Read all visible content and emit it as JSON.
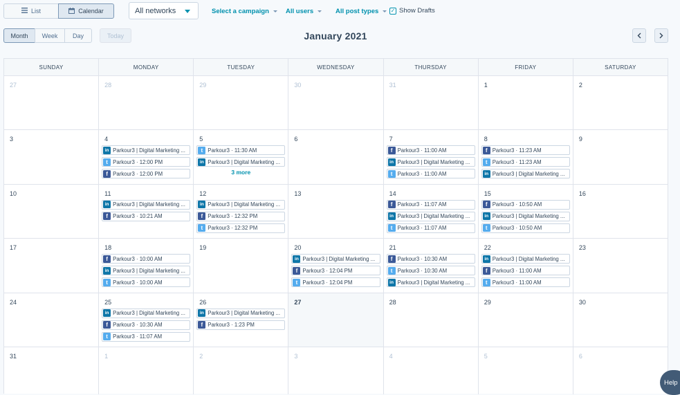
{
  "toolbar": {
    "view_toggle": {
      "list_label": "List",
      "calendar_label": "Calendar",
      "active": "Calendar"
    },
    "network_select": {
      "value": "All networks"
    },
    "campaign_filter": "Select a campaign",
    "users_filter": "All users",
    "post_types_filter": "All post types",
    "show_drafts": {
      "label": "Show Drafts",
      "checked": true
    }
  },
  "range_toggle": {
    "month": "Month",
    "week": "Week",
    "day": "Day",
    "active": "Month"
  },
  "today_label": "Today",
  "month_title": "January 2021",
  "nav": {
    "prev": "‹",
    "next": "›"
  },
  "weekdays": [
    "SUNDAY",
    "MONDAY",
    "TUESDAY",
    "WEDNESDAY",
    "THURSDAY",
    "FRIDAY",
    "SATURDAY"
  ],
  "weeks": [
    {
      "days": [
        {
          "num": "27",
          "other": true,
          "posts": []
        },
        {
          "num": "28",
          "other": true,
          "posts": []
        },
        {
          "num": "29",
          "other": true,
          "posts": []
        },
        {
          "num": "30",
          "other": true,
          "posts": []
        },
        {
          "num": "31",
          "other": true,
          "posts": []
        },
        {
          "num": "1",
          "posts": []
        },
        {
          "num": "2",
          "posts": []
        }
      ]
    },
    {
      "days": [
        {
          "num": "3",
          "posts": []
        },
        {
          "num": "4",
          "posts": [
            {
              "network": "linkedin",
              "text": "Parkour3 | Digital Marketing ..."
            },
            {
              "network": "twitter",
              "text": "Parkour3 · 12:00 PM"
            },
            {
              "network": "facebook",
              "text": "Parkour3 · 12:00 PM"
            }
          ]
        },
        {
          "num": "5",
          "posts": [
            {
              "network": "twitter",
              "text": "Parkour3 · 11:30 AM"
            },
            {
              "network": "linkedin",
              "text": "Parkour3 | Digital Marketing ..."
            }
          ],
          "more": "3 more"
        },
        {
          "num": "6",
          "posts": []
        },
        {
          "num": "7",
          "posts": [
            {
              "network": "facebook",
              "text": "Parkour3 · 11:00 AM"
            },
            {
              "network": "linkedin",
              "text": "Parkour3 | Digital Marketing ..."
            },
            {
              "network": "twitter",
              "text": "Parkour3 · 11:00 AM"
            }
          ]
        },
        {
          "num": "8",
          "posts": [
            {
              "network": "facebook",
              "text": "Parkour3 · 11:23 AM"
            },
            {
              "network": "twitter",
              "text": "Parkour3 · 11:23 AM"
            },
            {
              "network": "linkedin",
              "text": "Parkour3 | Digital Marketing ..."
            }
          ]
        },
        {
          "num": "9",
          "posts": []
        }
      ]
    },
    {
      "days": [
        {
          "num": "10",
          "posts": []
        },
        {
          "num": "11",
          "posts": [
            {
              "network": "linkedin",
              "text": "Parkour3 | Digital Marketing ..."
            },
            {
              "network": "facebook",
              "text": "Parkour3 · 10:21 AM"
            }
          ]
        },
        {
          "num": "12",
          "posts": [
            {
              "network": "linkedin",
              "text": "Parkour3 | Digital Marketing ..."
            },
            {
              "network": "facebook",
              "text": "Parkour3 · 12:32 PM"
            },
            {
              "network": "twitter",
              "text": "Parkour3 · 12:32 PM"
            }
          ]
        },
        {
          "num": "13",
          "posts": []
        },
        {
          "num": "14",
          "posts": [
            {
              "network": "facebook",
              "text": "Parkour3 · 11:07 AM"
            },
            {
              "network": "linkedin",
              "text": "Parkour3 | Digital Marketing ..."
            },
            {
              "network": "twitter",
              "text": "Parkour3 · 11:07 AM"
            }
          ]
        },
        {
          "num": "15",
          "posts": [
            {
              "network": "facebook",
              "text": "Parkour3 · 10:50 AM"
            },
            {
              "network": "linkedin",
              "text": "Parkour3 | Digital Marketing ..."
            },
            {
              "network": "twitter",
              "text": "Parkour3 · 10:50 AM"
            }
          ]
        },
        {
          "num": "16",
          "posts": []
        }
      ]
    },
    {
      "days": [
        {
          "num": "17",
          "posts": []
        },
        {
          "num": "18",
          "posts": [
            {
              "network": "facebook",
              "text": "Parkour3 · 10:00 AM"
            },
            {
              "network": "linkedin",
              "text": "Parkour3 | Digital Marketing ..."
            },
            {
              "network": "twitter",
              "text": "Parkour3 · 10:00 AM"
            }
          ]
        },
        {
          "num": "19",
          "posts": []
        },
        {
          "num": "20",
          "posts": [
            {
              "network": "linkedin",
              "text": "Parkour3 | Digital Marketing ..."
            },
            {
              "network": "facebook",
              "text": "Parkour3 · 12:04 PM"
            },
            {
              "network": "twitter",
              "text": "Parkour3 · 12:04 PM"
            }
          ]
        },
        {
          "num": "21",
          "posts": [
            {
              "network": "facebook",
              "text": "Parkour3 · 10:30 AM"
            },
            {
              "network": "twitter",
              "text": "Parkour3 · 10:30 AM"
            },
            {
              "network": "linkedin",
              "text": "Parkour3 | Digital Marketing ..."
            }
          ]
        },
        {
          "num": "22",
          "posts": [
            {
              "network": "linkedin",
              "text": "Parkour3 | Digital Marketing ..."
            },
            {
              "network": "facebook",
              "text": "Parkour3 · 11:00 AM"
            },
            {
              "network": "twitter",
              "text": "Parkour3 · 11:00 AM"
            }
          ]
        },
        {
          "num": "23",
          "posts": []
        }
      ]
    },
    {
      "days": [
        {
          "num": "24",
          "posts": []
        },
        {
          "num": "25",
          "posts": [
            {
              "network": "linkedin",
              "text": "Parkour3 | Digital Marketing ..."
            },
            {
              "network": "facebook",
              "text": "Parkour3 · 10:30 AM"
            },
            {
              "network": "twitter",
              "text": "Parkour3 · 11:07 AM"
            }
          ]
        },
        {
          "num": "26",
          "posts": [
            {
              "network": "linkedin",
              "text": "Parkour3 | Digital Marketing ..."
            },
            {
              "network": "facebook",
              "text": "Parkour3 · 1:23 PM"
            }
          ]
        },
        {
          "num": "27",
          "today": true,
          "posts": []
        },
        {
          "num": "28",
          "posts": []
        },
        {
          "num": "29",
          "posts": []
        },
        {
          "num": "30",
          "posts": []
        }
      ]
    },
    {
      "days": [
        {
          "num": "31",
          "posts": []
        },
        {
          "num": "1",
          "other": true,
          "posts": []
        },
        {
          "num": "2",
          "other": true,
          "posts": []
        },
        {
          "num": "3",
          "other": true,
          "posts": []
        },
        {
          "num": "4",
          "other": true,
          "posts": []
        },
        {
          "num": "5",
          "other": true,
          "posts": []
        },
        {
          "num": "6",
          "other": true,
          "posts": []
        }
      ]
    }
  ],
  "network_icons": {
    "facebook": "f",
    "linkedin": "in",
    "twitter": "t"
  },
  "colors": {
    "facebook": "#3b5998",
    "linkedin": "#0e76a8",
    "twitter": "#55acee",
    "accent": "#0091ae"
  },
  "help_label": "Help"
}
